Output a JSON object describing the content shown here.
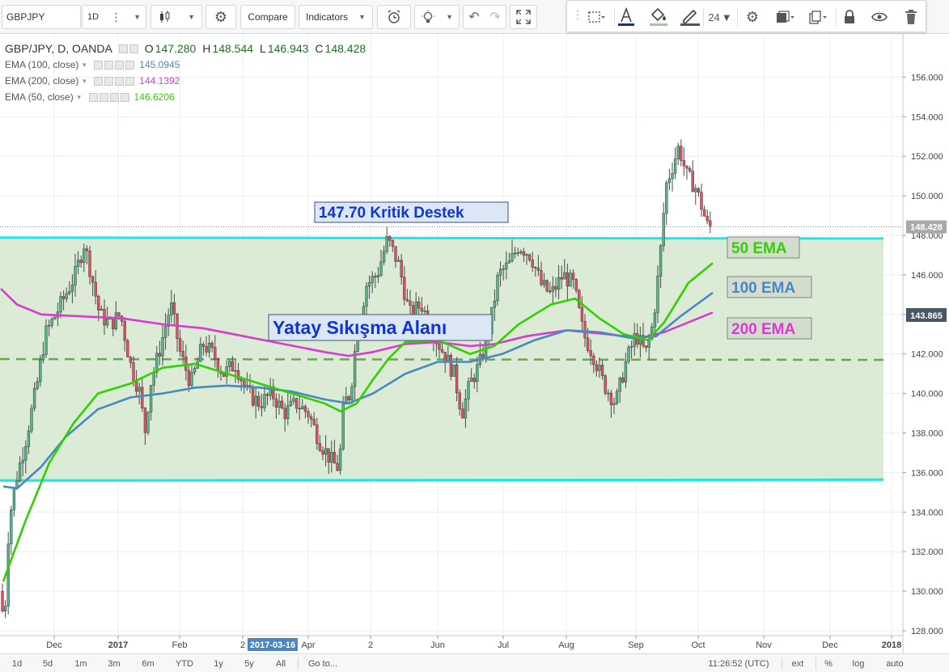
{
  "toolbar": {
    "symbol": "GBPJPY",
    "interval": "1D",
    "compare_label": "Compare",
    "indicators_label": "Indicators",
    "font_size": "24"
  },
  "legend": {
    "title": "GBP/JPY, D, OANDA",
    "open_label": "O",
    "open": "147.280",
    "high_label": "H",
    "high": "148.544",
    "low_label": "L",
    "low": "146.943",
    "close_label": "C",
    "close": "148.428",
    "indicators": [
      {
        "label": "EMA (100, close)",
        "value": "145.0945",
        "color": "#4a88c2"
      },
      {
        "label": "EMA (200, close)",
        "value": "144.1392",
        "color": "#d83bd2"
      },
      {
        "label": "EMA (50, close)",
        "value": "146.6206",
        "color": "#31d000"
      }
    ]
  },
  "annotations": {
    "support_label": "147.70 Kritik Destek",
    "range_label": "Yatay Sıkışma Alanı",
    "ema50_label": "50 EMA",
    "ema100_label": "100 EMA",
    "ema200_label": "200 EMA"
  },
  "price_axis": {
    "ticks": [
      "156.000",
      "154.000",
      "152.000",
      "150.000",
      "148.000",
      "146.000",
      "144.000",
      "142.000",
      "140.000",
      "138.000",
      "136.000",
      "134.000",
      "132.000",
      "130.000",
      "128.000"
    ],
    "last_price": "148.428",
    "cursor_price": "143.865"
  },
  "time_axis": {
    "ticks": [
      "Dec",
      "2017",
      "Feb",
      "2",
      "Apr",
      "2",
      "Jun",
      "Jul",
      "Aug",
      "Sep",
      "Oct",
      "Nov",
      "Dec",
      "2018"
    ],
    "cursor_date": "2017-03-16"
  },
  "bottom_bar": {
    "ranges": [
      "1d",
      "5d",
      "1m",
      "3m",
      "6m",
      "YTD",
      "1y",
      "5y",
      "All"
    ],
    "goto_label": "Go to...",
    "clock": "11:26:52 (UTC)",
    "ext_label": "ext",
    "percent_label": "%",
    "log_label": "log",
    "auto_label": "auto"
  },
  "colors": {
    "candle_up": "#53b987",
    "candle_down": "#eb4d5c",
    "ema50": "#31d000",
    "ema100": "#4a88c2",
    "ema200": "#d83bd2",
    "channel": "#1ee6e6",
    "zone_fill": "#d9ead3",
    "midline": "#6aa84f"
  },
  "chart_data": {
    "type": "candlestick",
    "symbol": "GBP/JPY",
    "timeframe": "D",
    "ylim": [
      127.5,
      157.8
    ],
    "support_level": 147.7,
    "range_top": 147.8,
    "range_bottom": 135.6,
    "range_mid": 141.7,
    "ohlc_last": {
      "open": 147.28,
      "high": 148.544,
      "low": 146.943,
      "close": 148.428
    },
    "price_path": [
      {
        "x": 0,
        "y": 130.0
      },
      {
        "x": 4,
        "y": 128.0
      },
      {
        "x": 10,
        "y": 133.5
      },
      {
        "x": 18,
        "y": 135.5
      },
      {
        "x": 30,
        "y": 137.5
      },
      {
        "x": 45,
        "y": 140.5
      },
      {
        "x": 55,
        "y": 143.0
      },
      {
        "x": 68,
        "y": 144.0
      },
      {
        "x": 80,
        "y": 145.0
      },
      {
        "x": 92,
        "y": 146.0
      },
      {
        "x": 103,
        "y": 147.6
      },
      {
        "x": 112,
        "y": 146.0
      },
      {
        "x": 122,
        "y": 144.0
      },
      {
        "x": 135,
        "y": 143.5
      },
      {
        "x": 148,
        "y": 144.0
      },
      {
        "x": 160,
        "y": 141.5
      },
      {
        "x": 172,
        "y": 140.0
      },
      {
        "x": 178,
        "y": 138.0
      },
      {
        "x": 185,
        "y": 140.5
      },
      {
        "x": 195,
        "y": 142.0
      },
      {
        "x": 210,
        "y": 144.5
      },
      {
        "x": 222,
        "y": 142.0
      },
      {
        "x": 235,
        "y": 140.5
      },
      {
        "x": 250,
        "y": 142.5
      },
      {
        "x": 262,
        "y": 142.0
      },
      {
        "x": 275,
        "y": 141.0
      },
      {
        "x": 290,
        "y": 141.5
      },
      {
        "x": 305,
        "y": 140.0
      },
      {
        "x": 320,
        "y": 139.5
      },
      {
        "x": 335,
        "y": 140.0
      },
      {
        "x": 350,
        "y": 139.0
      },
      {
        "x": 365,
        "y": 139.5
      },
      {
        "x": 380,
        "y": 139.0
      },
      {
        "x": 395,
        "y": 137.5
      },
      {
        "x": 410,
        "y": 136.5
      },
      {
        "x": 418,
        "y": 136.2
      },
      {
        "x": 424,
        "y": 139.5
      },
      {
        "x": 432,
        "y": 140.0
      },
      {
        "x": 440,
        "y": 143.0
      },
      {
        "x": 452,
        "y": 145.5
      },
      {
        "x": 465,
        "y": 146.0
      },
      {
        "x": 478,
        "y": 147.8
      },
      {
        "x": 492,
        "y": 146.5
      },
      {
        "x": 505,
        "y": 144.0
      },
      {
        "x": 520,
        "y": 144.5
      },
      {
        "x": 535,
        "y": 143.0
      },
      {
        "x": 548,
        "y": 142.0
      },
      {
        "x": 560,
        "y": 141.0
      },
      {
        "x": 570,
        "y": 139.0
      },
      {
        "x": 580,
        "y": 140.5
      },
      {
        "x": 592,
        "y": 141.5
      },
      {
        "x": 605,
        "y": 143.5
      },
      {
        "x": 615,
        "y": 146.0
      },
      {
        "x": 628,
        "y": 146.5
      },
      {
        "x": 640,
        "y": 147.5
      },
      {
        "x": 655,
        "y": 147.0
      },
      {
        "x": 668,
        "y": 145.5
      },
      {
        "x": 680,
        "y": 145.0
      },
      {
        "x": 695,
        "y": 146.0
      },
      {
        "x": 708,
        "y": 145.5
      },
      {
        "x": 720,
        "y": 143.0
      },
      {
        "x": 732,
        "y": 142.0
      },
      {
        "x": 745,
        "y": 140.5
      },
      {
        "x": 760,
        "y": 139.5
      },
      {
        "x": 772,
        "y": 141.5
      },
      {
        "x": 785,
        "y": 143.0
      },
      {
        "x": 797,
        "y": 142.0
      },
      {
        "x": 806,
        "y": 143.5
      },
      {
        "x": 814,
        "y": 146.5
      },
      {
        "x": 822,
        "y": 150.5
      },
      {
        "x": 830,
        "y": 151.5
      },
      {
        "x": 838,
        "y": 152.5
      },
      {
        "x": 848,
        "y": 151.0
      },
      {
        "x": 858,
        "y": 150.5
      },
      {
        "x": 866,
        "y": 149.5
      },
      {
        "x": 873,
        "y": 148.5
      },
      {
        "x": 880,
        "y": 148.4
      }
    ],
    "ema50": [
      {
        "x": 3,
        "y": 130.5
      },
      {
        "x": 30,
        "y": 133.5
      },
      {
        "x": 60,
        "y": 136.5
      },
      {
        "x": 90,
        "y": 138.5
      },
      {
        "x": 120,
        "y": 140.0
      },
      {
        "x": 160,
        "y": 140.5
      },
      {
        "x": 200,
        "y": 141.3
      },
      {
        "x": 240,
        "y": 141.5
      },
      {
        "x": 280,
        "y": 141.0
      },
      {
        "x": 320,
        "y": 140.5
      },
      {
        "x": 360,
        "y": 140.0
      },
      {
        "x": 400,
        "y": 139.5
      },
      {
        "x": 420,
        "y": 139.1
      },
      {
        "x": 440,
        "y": 139.5
      },
      {
        "x": 460,
        "y": 140.7
      },
      {
        "x": 480,
        "y": 141.8
      },
      {
        "x": 500,
        "y": 142.6
      },
      {
        "x": 540,
        "y": 142.7
      },
      {
        "x": 580,
        "y": 142.0
      },
      {
        "x": 610,
        "y": 142.4
      },
      {
        "x": 640,
        "y": 143.5
      },
      {
        "x": 680,
        "y": 144.5
      },
      {
        "x": 710,
        "y": 144.8
      },
      {
        "x": 740,
        "y": 143.8
      },
      {
        "x": 770,
        "y": 143.0
      },
      {
        "x": 800,
        "y": 142.7
      },
      {
        "x": 820,
        "y": 143.6
      },
      {
        "x": 850,
        "y": 145.6
      },
      {
        "x": 880,
        "y": 146.6
      }
    ],
    "ema100": [
      {
        "x": 3,
        "y": 135.3
      },
      {
        "x": 20,
        "y": 135.2
      },
      {
        "x": 50,
        "y": 136.3
      },
      {
        "x": 80,
        "y": 137.8
      },
      {
        "x": 120,
        "y": 139.2
      },
      {
        "x": 160,
        "y": 139.8
      },
      {
        "x": 200,
        "y": 140.0
      },
      {
        "x": 240,
        "y": 140.3
      },
      {
        "x": 280,
        "y": 140.4
      },
      {
        "x": 320,
        "y": 140.3
      },
      {
        "x": 360,
        "y": 140.1
      },
      {
        "x": 400,
        "y": 139.7
      },
      {
        "x": 430,
        "y": 139.5
      },
      {
        "x": 460,
        "y": 140.0
      },
      {
        "x": 500,
        "y": 141.0
      },
      {
        "x": 540,
        "y": 141.6
      },
      {
        "x": 580,
        "y": 141.6
      },
      {
        "x": 620,
        "y": 142.0
      },
      {
        "x": 660,
        "y": 142.7
      },
      {
        "x": 700,
        "y": 143.2
      },
      {
        "x": 740,
        "y": 143.1
      },
      {
        "x": 780,
        "y": 142.8
      },
      {
        "x": 810,
        "y": 142.9
      },
      {
        "x": 840,
        "y": 143.9
      },
      {
        "x": 880,
        "y": 145.1
      }
    ],
    "ema200": [
      {
        "x": 0,
        "y": 145.3
      },
      {
        "x": 20,
        "y": 144.5
      },
      {
        "x": 50,
        "y": 144.0
      },
      {
        "x": 100,
        "y": 143.9
      },
      {
        "x": 150,
        "y": 143.8
      },
      {
        "x": 200,
        "y": 143.5
      },
      {
        "x": 250,
        "y": 143.3
      },
      {
        "x": 300,
        "y": 142.9
      },
      {
        "x": 350,
        "y": 142.5
      },
      {
        "x": 400,
        "y": 142.1
      },
      {
        "x": 430,
        "y": 141.9
      },
      {
        "x": 460,
        "y": 142.1
      },
      {
        "x": 500,
        "y": 142.5
      },
      {
        "x": 540,
        "y": 142.6
      },
      {
        "x": 580,
        "y": 142.4
      },
      {
        "x": 610,
        "y": 142.5
      },
      {
        "x": 650,
        "y": 142.9
      },
      {
        "x": 700,
        "y": 143.2
      },
      {
        "x": 750,
        "y": 143.0
      },
      {
        "x": 790,
        "y": 142.8
      },
      {
        "x": 820,
        "y": 143.1
      },
      {
        "x": 850,
        "y": 143.6
      },
      {
        "x": 880,
        "y": 144.1
      }
    ]
  }
}
